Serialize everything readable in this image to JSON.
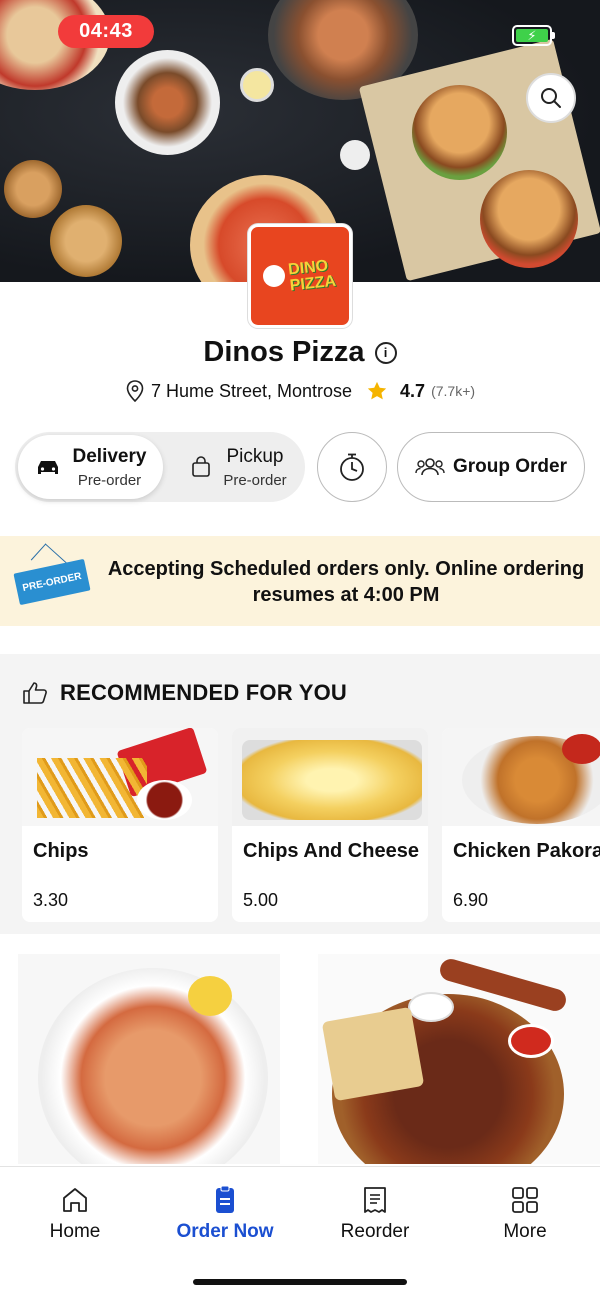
{
  "status": {
    "time": "04:43"
  },
  "restaurant": {
    "name": "Dinos Pizza",
    "logo_text": "DINO PIZZA",
    "address": "7 Hume Street, Montrose",
    "rating": "4.7",
    "rating_count": "(7.7k+)"
  },
  "modes": {
    "delivery": {
      "label": "Delivery",
      "sub": "Pre-order"
    },
    "pickup": {
      "label": "Pickup",
      "sub": "Pre-order"
    },
    "group_order": "Group Order"
  },
  "banner": {
    "tag": "PRE-ORDER",
    "text": "Accepting Scheduled orders only. Online ordering resumes at 4:00 PM"
  },
  "recommended": {
    "heading": "RECOMMENDED FOR YOU",
    "items": [
      {
        "name": "Chips",
        "price": "3.30"
      },
      {
        "name": "Chips And Cheese",
        "price": "5.00"
      },
      {
        "name": "Chicken Pakora",
        "price": "6.90"
      }
    ]
  },
  "nav": {
    "items": [
      {
        "label": "Home",
        "icon": "home-icon"
      },
      {
        "label": "Order Now",
        "icon": "order-icon"
      },
      {
        "label": "Reorder",
        "icon": "receipt-icon"
      },
      {
        "label": "More",
        "icon": "grid-icon"
      }
    ],
    "active_color": "#1b4fd1"
  },
  "colors": {
    "accent": "#f23b3b",
    "banner_bg": "#fcf3dc",
    "star": "#f5b400"
  }
}
